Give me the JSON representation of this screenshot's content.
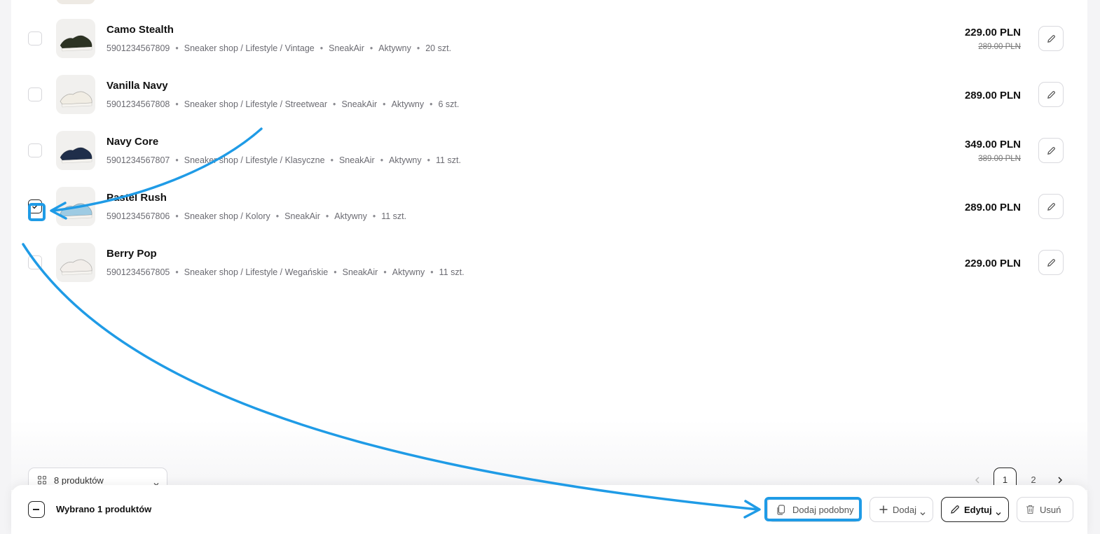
{
  "products": [
    {
      "name": "Camo Stealth",
      "ean": "5901234567809",
      "category": "Sneaker shop / Lifestyle / Vintage",
      "brand": "SneakAir",
      "status": "Aktywny",
      "stock": "20 szt.",
      "price": "229.00 PLN",
      "old_price": "289.00 PLN",
      "checked": false,
      "shoe_color": "#2d3323"
    },
    {
      "name": "Vanilla Navy",
      "ean": "5901234567808",
      "category": "Sneaker shop / Lifestyle / Streetwear",
      "brand": "SneakAir",
      "status": "Aktywny",
      "stock": "6 szt.",
      "price": "289.00 PLN",
      "old_price": "",
      "checked": false,
      "shoe_color": "#f1ede4"
    },
    {
      "name": "Navy Core",
      "ean": "5901234567807",
      "category": "Sneaker shop / Lifestyle / Klasyczne",
      "brand": "SneakAir",
      "status": "Aktywny",
      "stock": "11 szt.",
      "price": "349.00 PLN",
      "old_price": "389.00 PLN",
      "checked": false,
      "shoe_color": "#1f2e4a"
    },
    {
      "name": "Pastel Rush",
      "ean": "5901234567806",
      "category": "Sneaker shop / Kolory",
      "brand": "SneakAir",
      "status": "Aktywny",
      "stock": "11 szt.",
      "price": "289.00 PLN",
      "old_price": "",
      "checked": true,
      "shoe_color": "#9ecbe3"
    },
    {
      "name": "Berry Pop",
      "ean": "5901234567805",
      "category": "Sneaker shop / Lifestyle / Wegańskie",
      "brand": "SneakAir",
      "status": "Aktywny",
      "stock": "11 szt.",
      "price": "229.00 PLN",
      "old_price": "",
      "checked": false,
      "shoe_color": "#f2eeea"
    }
  ],
  "footer": {
    "count_label": "8 produktów",
    "pages": [
      "1",
      "2"
    ],
    "current_page": "1"
  },
  "selection_bar": {
    "selected_text": "Wybrano 1 produktów",
    "similar_label": "Dodaj podobny",
    "add_label": "Dodaj",
    "edit_label": "Edytuj",
    "delete_label": "Usuń"
  },
  "colors": {
    "highlight": "#1f9be6",
    "text": "#111111",
    "muted": "#6b6b72"
  }
}
